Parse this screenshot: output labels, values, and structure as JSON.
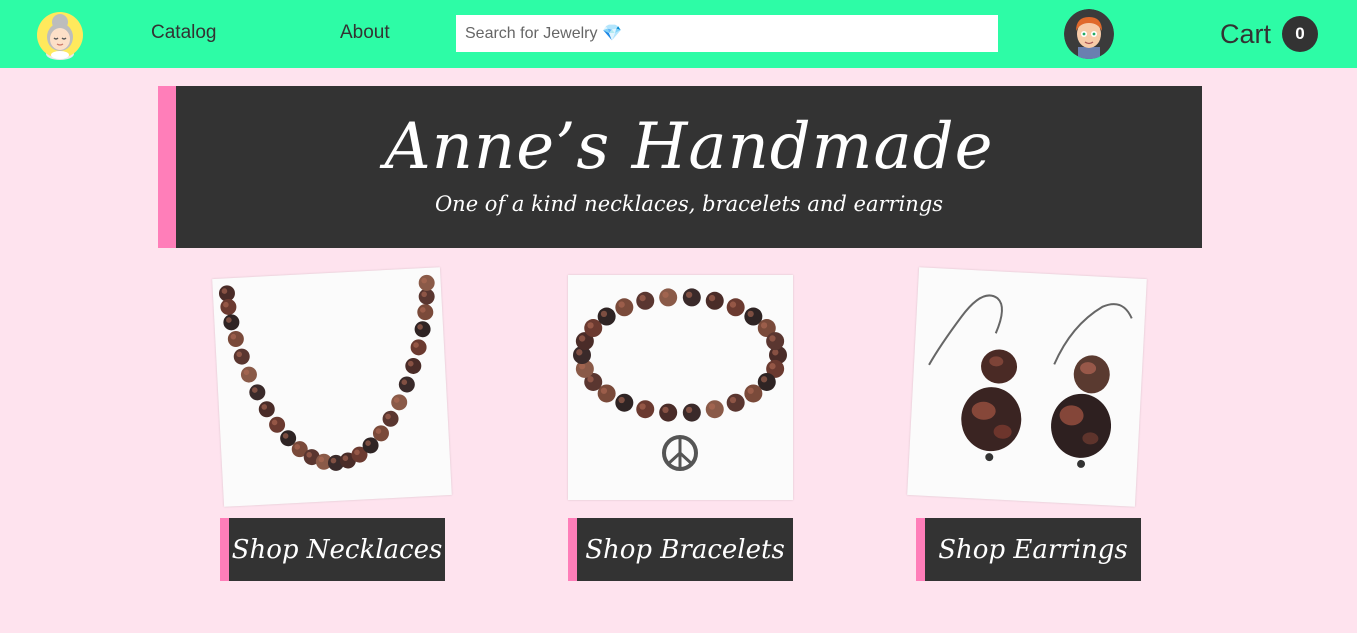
{
  "nav": {
    "logo_icon": "meditating-grandma-logo-icon",
    "catalog_label": "Catalog",
    "about_label": "About",
    "search_placeholder": "Search for Jewelry 💎",
    "avatar_icon": "user-avatar-icon",
    "cart_label": "Cart",
    "cart_count": "0"
  },
  "hero": {
    "title": "Anne’s Handmade",
    "subtitle": "One of a kind necklaces, bracelets and earrings"
  },
  "products": [
    {
      "image_icon": "necklace-photo",
      "button_label": "Shop Necklaces"
    },
    {
      "image_icon": "bracelet-photo",
      "button_label": "Shop Bracelets"
    },
    {
      "image_icon": "earrings-photo",
      "button_label": "Shop Earrings"
    }
  ],
  "colors": {
    "nav_bg": "#2dfca6",
    "page_bg": "#fee3ee",
    "panel_bg": "#333333",
    "accent_pink": "#ff7eb9"
  }
}
